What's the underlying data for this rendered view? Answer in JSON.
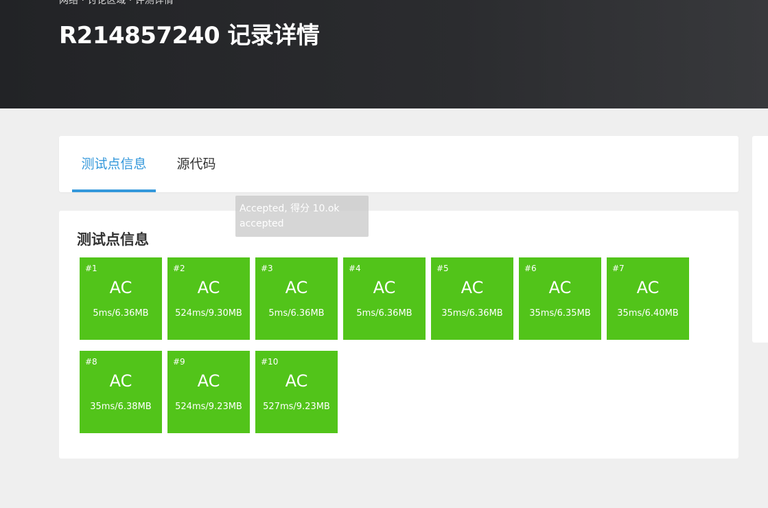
{
  "header": {
    "breadcrumb": "网络 · 讨论区域 · 评测详情",
    "title": "R214857240 记录详情"
  },
  "tabs": [
    {
      "label": "测试点信息",
      "active": true
    },
    {
      "label": "源代码",
      "active": false
    }
  ],
  "tooltip": {
    "line1": "Accepted, 得分 10.ok",
    "line2": "accepted"
  },
  "main": {
    "section_title": "测试点信息",
    "testcases": [
      {
        "id": "#1",
        "status": "AC",
        "info": "5ms/6.36MB"
      },
      {
        "id": "#2",
        "status": "AC",
        "info": "524ms/9.30MB"
      },
      {
        "id": "#3",
        "status": "AC",
        "info": "5ms/6.36MB"
      },
      {
        "id": "#4",
        "status": "AC",
        "info": "5ms/6.36MB"
      },
      {
        "id": "#5",
        "status": "AC",
        "info": "35ms/6.36MB"
      },
      {
        "id": "#6",
        "status": "AC",
        "info": "35ms/6.35MB"
      },
      {
        "id": "#7",
        "status": "AC",
        "info": "35ms/6.40MB"
      },
      {
        "id": "#8",
        "status": "AC",
        "info": "35ms/6.38MB"
      },
      {
        "id": "#9",
        "status": "AC",
        "info": "524ms/9.23MB"
      },
      {
        "id": "#10",
        "status": "AC",
        "info": "527ms/9.23MB"
      }
    ]
  },
  "colors": {
    "accent": "#3498db",
    "ac_green": "#52c41a",
    "header_bg": "#2b2c2f",
    "page_bg": "#efefef"
  }
}
